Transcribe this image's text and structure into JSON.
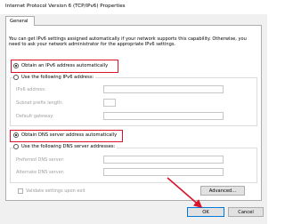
{
  "window": {
    "title": "Internet Protocol Version 6 (TCP/IPv6) Properties"
  },
  "tabs": [
    {
      "label": "General"
    }
  ],
  "description": "You can get IPv6 settings assigned automatically if your network supports this capability. Otherwise, you need to ask your network administrator for the appropriate IPv6 settings.",
  "ip_section": {
    "auto_label": "Obtain an IPv6 address automatically",
    "manual_label": "Use the following IPv6 address:",
    "fields": {
      "address_label": "IPv6 address:",
      "prefix_label": "Subnet prefix length:",
      "gateway_label": "Default gateway:"
    }
  },
  "dns_section": {
    "auto_label": "Obtain DNS server address automatically",
    "manual_label": "Use the following DNS server addresses:",
    "fields": {
      "preferred_label": "Preferred DNS server:",
      "alternate_label": "Alternate DNS server:"
    }
  },
  "validate_label": "Validate settings upon exit",
  "buttons": {
    "advanced": "Advanced...",
    "ok": "OK",
    "cancel": "Cancel"
  },
  "colors": {
    "highlight": "#d9142b",
    "default_button_border": "#0078d7"
  }
}
